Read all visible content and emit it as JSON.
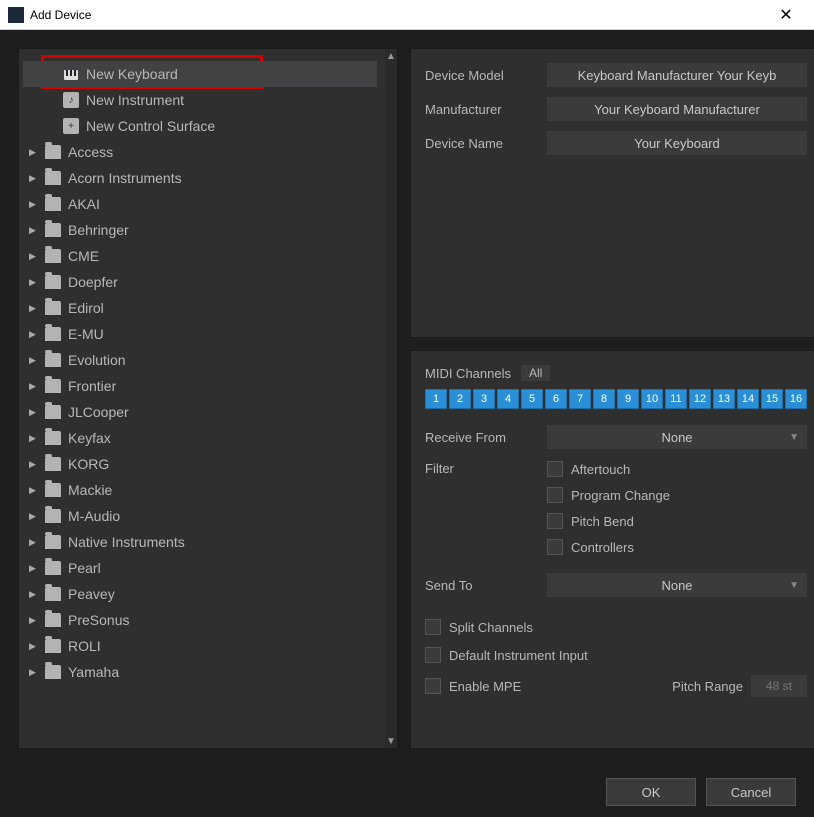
{
  "window": {
    "title": "Add Device"
  },
  "tree": {
    "topItems": [
      {
        "label": "New Keyboard",
        "icon": "keyboard",
        "selected": true
      },
      {
        "label": "New Instrument",
        "icon": "instrument"
      },
      {
        "label": "New Control Surface",
        "icon": "surface"
      }
    ],
    "folders": [
      "Access",
      "Acorn Instruments",
      "AKAI",
      "Behringer",
      "CME",
      "Doepfer",
      "Edirol",
      "E-MU",
      "Evolution",
      "Frontier",
      "JLCooper",
      "Keyfax",
      "KORG",
      "Mackie",
      "M-Audio",
      "Native Instruments",
      "Pearl",
      "Peavey",
      "PreSonus",
      "ROLI",
      "Yamaha"
    ]
  },
  "info": {
    "deviceModelLabel": "Device Model",
    "deviceModelValue": "Keyboard Manufacturer Your Keyb",
    "manufacturerLabel": "Manufacturer",
    "manufacturerValue": "Your Keyboard Manufacturer",
    "deviceNameLabel": "Device Name",
    "deviceNameValue": "Your Keyboard"
  },
  "midi": {
    "heading": "MIDI Channels",
    "allLabel": "All",
    "channels": [
      "1",
      "2",
      "3",
      "4",
      "5",
      "6",
      "7",
      "8",
      "9",
      "10",
      "11",
      "12",
      "13",
      "14",
      "15",
      "16"
    ],
    "receiveLabel": "Receive From",
    "receiveValue": "None",
    "filterLabel": "Filter",
    "filters": [
      "Aftertouch",
      "Program Change",
      "Pitch Bend",
      "Controllers"
    ],
    "sendLabel": "Send To",
    "sendValue": "None",
    "splitLabel": "Split Channels",
    "defaultInputLabel": "Default Instrument Input",
    "mpeLabel": "Enable MPE",
    "pitchRangeLabel": "Pitch Range",
    "pitchRangeValue": "48 st"
  },
  "buttons": {
    "ok": "OK",
    "cancel": "Cancel"
  }
}
